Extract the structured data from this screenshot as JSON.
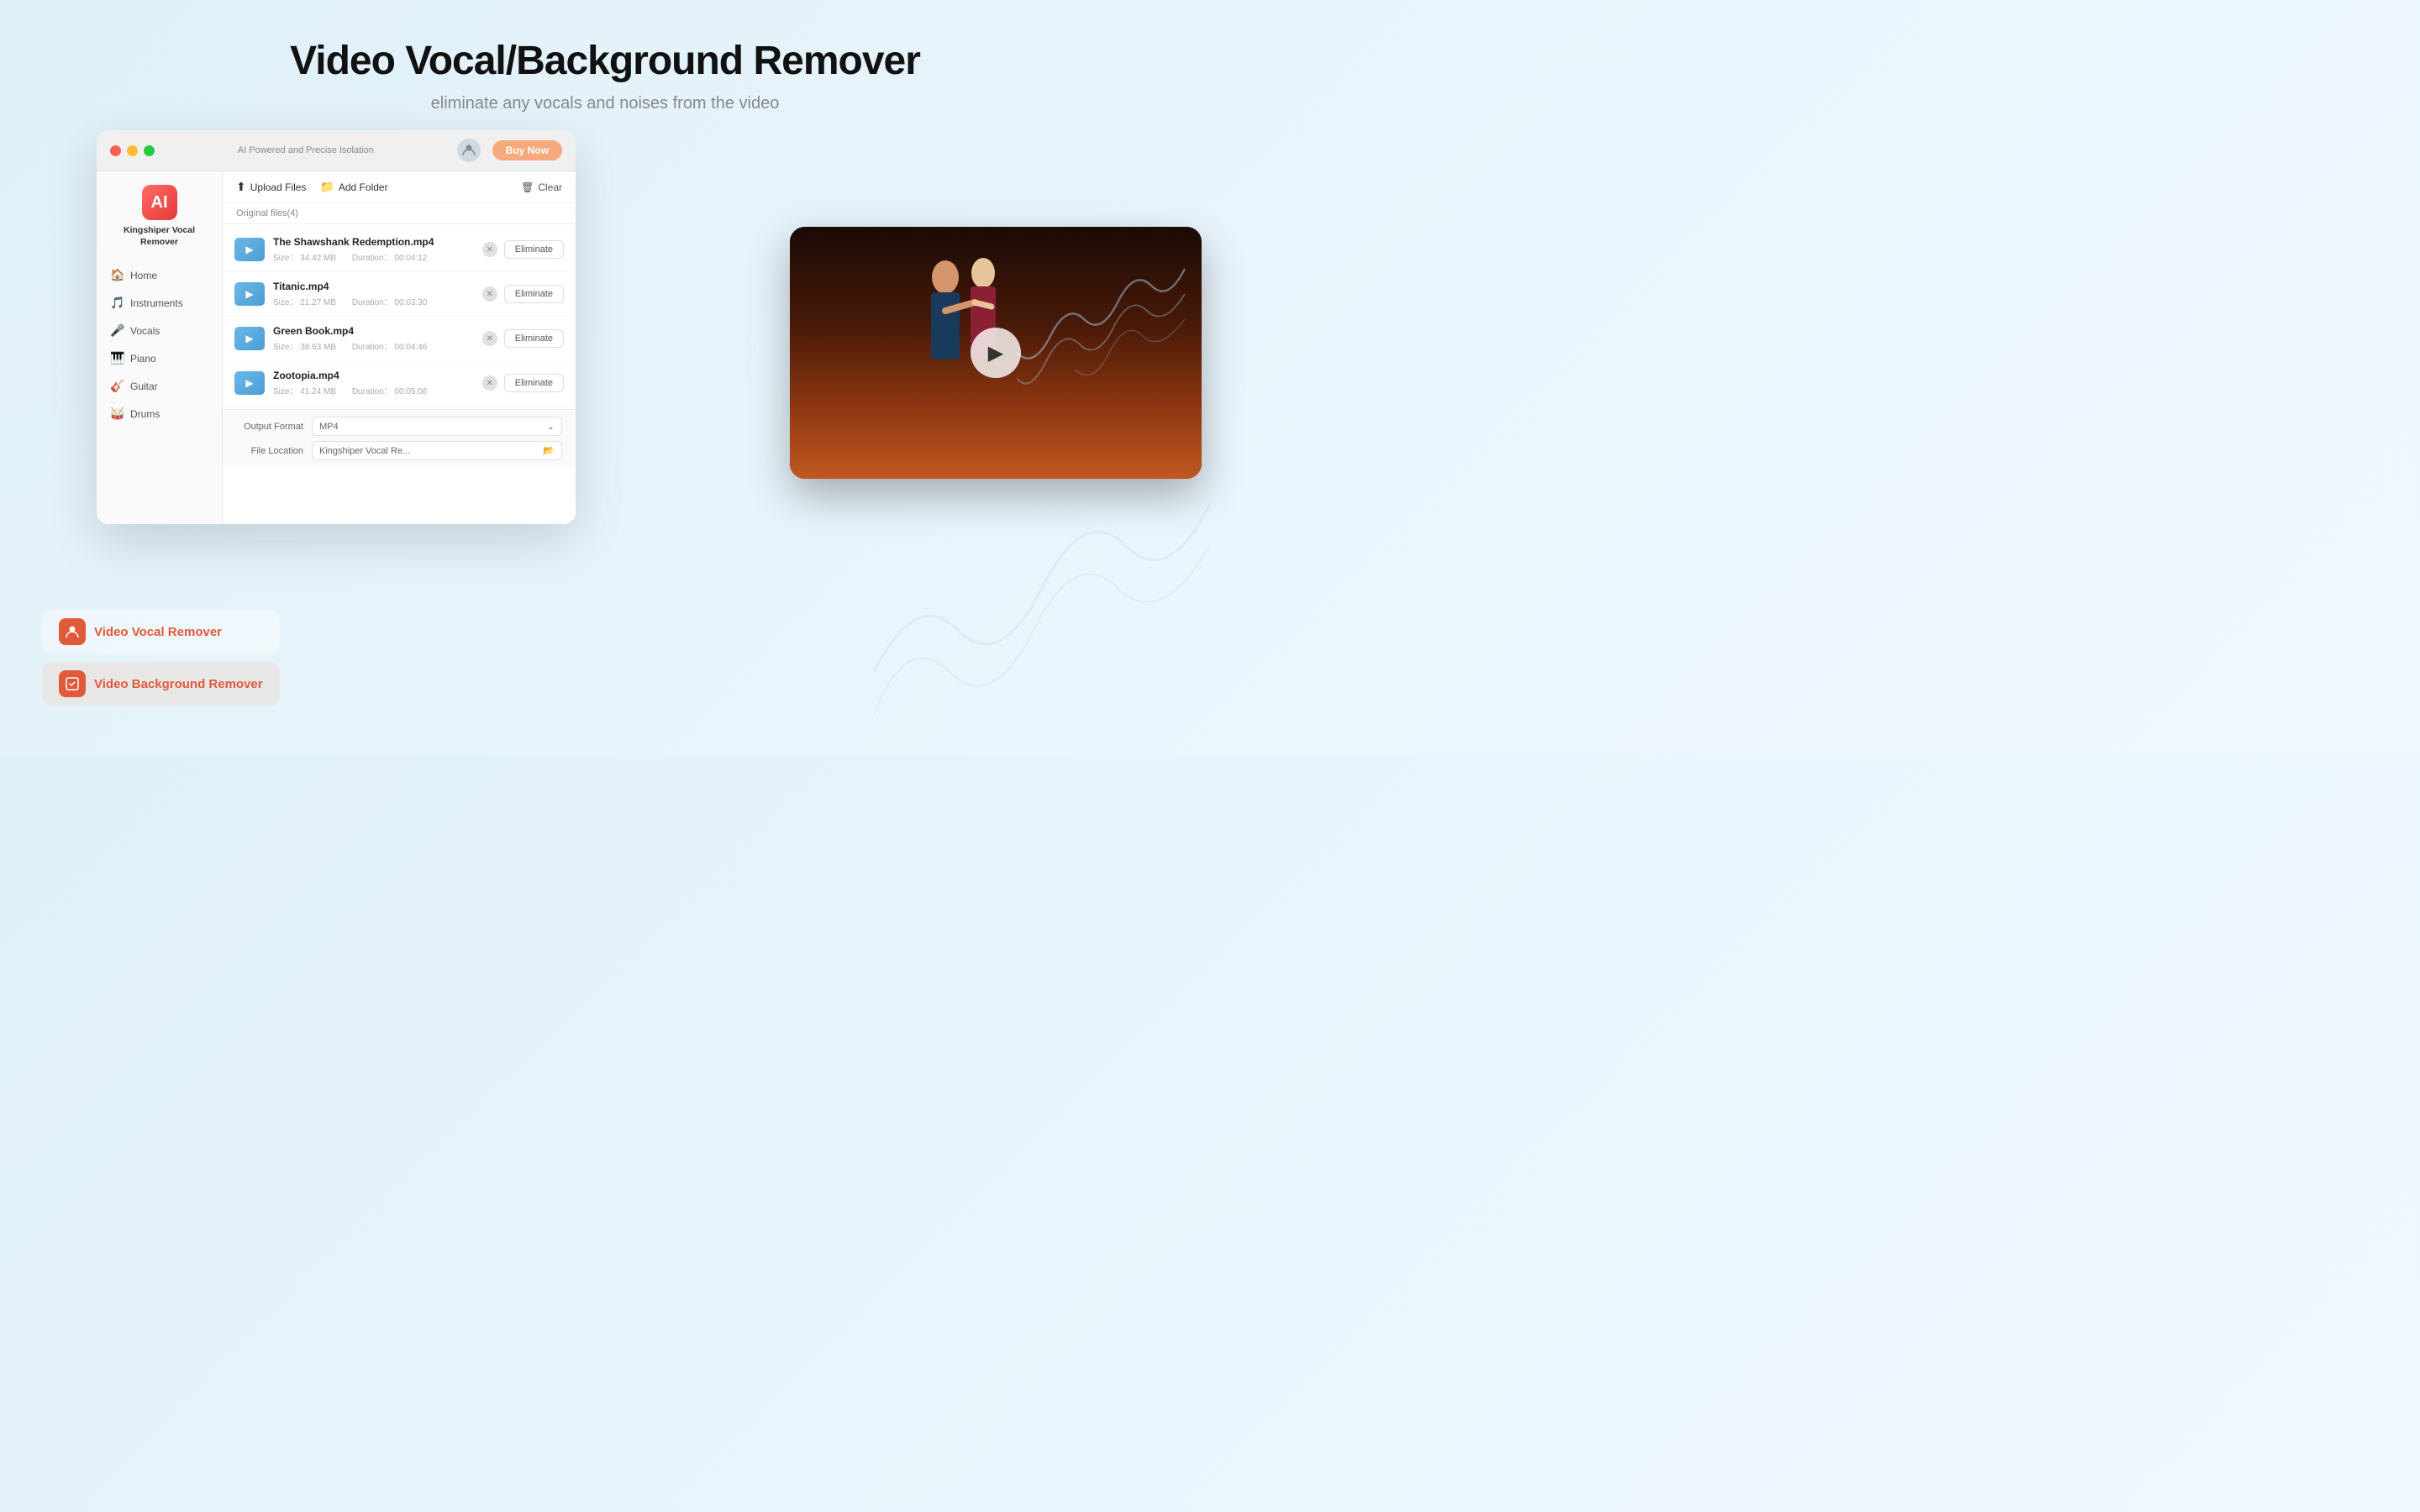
{
  "header": {
    "title": "Video Vocal/Background Remover",
    "subtitle": "eliminate any vocals and noises from the video"
  },
  "titleBar": {
    "label": "AI Powered and Precise Isolation",
    "buyNow": "Buy Now"
  },
  "sidebar": {
    "appName": "Kingshiper Vocal Remover",
    "items": [
      {
        "id": "home",
        "label": "Home",
        "icon": "🏠"
      },
      {
        "id": "instruments",
        "label": "Instruments",
        "icon": "🎵"
      },
      {
        "id": "vocals",
        "label": "Vocals",
        "icon": "🎤"
      },
      {
        "id": "piano",
        "label": "Piano",
        "icon": "🎹"
      },
      {
        "id": "guitar",
        "label": "Guitar",
        "icon": "🎸"
      },
      {
        "id": "drums",
        "label": "Drums",
        "icon": "🥁"
      }
    ]
  },
  "toolbar": {
    "uploadLabel": "Upload Files",
    "addFolderLabel": "Add Folder",
    "clearLabel": "Clear"
  },
  "fileList": {
    "countLabel": "Original files(4)",
    "files": [
      {
        "name": "The Shawshank Redemption.mp4",
        "size": "34.42 MB",
        "duration": "00:04:12"
      },
      {
        "name": "Titanic.mp4",
        "size": "21.27 MB",
        "duration": "00:03:30"
      },
      {
        "name": "Green Book.mp4",
        "size": "38.63 MB",
        "duration": "00:04:46"
      },
      {
        "name": "Zootopia.mp4",
        "size": "41.24 MB",
        "duration": "00:05:06"
      }
    ],
    "eliminateLabel": "Eliminate"
  },
  "bottomBar": {
    "outputFormatLabel": "Output Format",
    "outputFormatValue": "MP4",
    "fileLocationLabel": "File Location",
    "fileLocationValue": "Kingshiper Vocal Re..."
  },
  "featureButtons": {
    "vocalRemover": "Video Vocal Remover",
    "bgRemover": "Video Background Remover"
  },
  "icons": {
    "upload": "⬆",
    "addFolder": "📁",
    "clear": "🗑",
    "play": "▶",
    "close": "✕",
    "chevron": "⌄"
  }
}
